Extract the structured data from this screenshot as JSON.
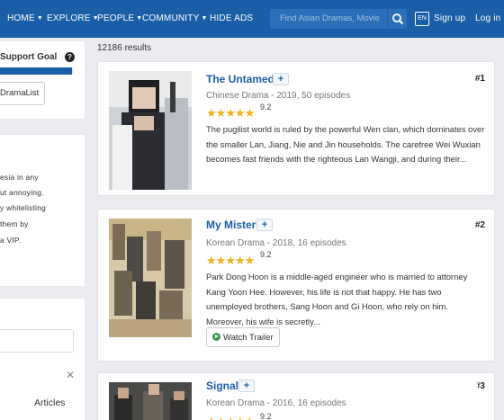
{
  "nav": {
    "items": [
      {
        "label": "HOME",
        "caret": true
      },
      {
        "label": "EXPLORE",
        "caret": true
      },
      {
        "label": "PEOPLE",
        "caret": true
      },
      {
        "label": "COMMUNITY",
        "caret": true
      },
      {
        "label": "HIDE ADS",
        "caret": false
      }
    ],
    "search_placeholder": "Find Asian Dramas, Movie",
    "lang": "EN",
    "signup": "Sign up",
    "login": "Log in"
  },
  "sidebar": {
    "support_title": "Support Goal",
    "support_button": "DramaList",
    "goal_progress_fraction": 0.98,
    "ad_lines": [
      "esia in any",
      "ut annoying.",
      "y whitelisting",
      "them by",
      "a VIP."
    ],
    "articles_label": "Articles"
  },
  "results": {
    "count_text": "12186 results",
    "items": [
      {
        "title": "The Untamed",
        "meta": "Chinese Drama - 2019, 50 episodes",
        "rating": "9.2",
        "rank": "#1",
        "description": "The pugilist world is ruled by the powerful Wen clan, which dominates over the smaller Lan, Jiang, Nie and Jin households. The carefree Wei Wuxian becomes fast friends with the righteous Lan Wangji, and during their..."
      },
      {
        "title": "My Mister",
        "meta": "Korean Drama - 2018, 16 episodes",
        "rating": "9.2",
        "rank": "#2",
        "description": "Park Dong Hoon is a middle-aged engineer who is married to attorney Kang Yoon Hee. However, his life is not that happy. He has two unemployed brothers, Sang Hoon and Gi Hoon, who rely on him. Moreover, his wife is secretly...",
        "trailer_label": "Watch Trailer"
      },
      {
        "title": "Signal",
        "meta": "Korean Drama - 2016, 16 episodes",
        "rating": "9.2",
        "rank": "#3"
      }
    ]
  },
  "colors": {
    "nav_bg": "#1a5ea8",
    "link": "#1a5ea8",
    "star": "#f2b01e",
    "page_bg": "#e9ebee"
  }
}
